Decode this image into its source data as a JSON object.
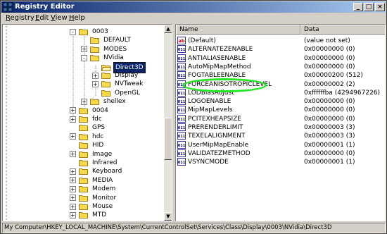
{
  "window": {
    "title": "Registry Editor"
  },
  "menu": [
    {
      "label": "Registry",
      "u": "R",
      "rest": "egistry"
    },
    {
      "label": "Edit",
      "u": "E",
      "rest": "dit"
    },
    {
      "label": "View",
      "u": "V",
      "rest": "iew"
    },
    {
      "label": "Help",
      "u": "H",
      "rest": "elp"
    }
  ],
  "tree": [
    {
      "label": "0003",
      "expander": "-",
      "level": 0
    },
    {
      "label": "DEFAULT",
      "expander": "",
      "level": 1
    },
    {
      "label": "MODES",
      "expander": "+",
      "level": 1
    },
    {
      "label": "NVidia",
      "expander": "-",
      "level": 1
    },
    {
      "label": "Direct3D",
      "expander": "",
      "level": 2,
      "selected": true
    },
    {
      "label": "Display",
      "expander": "+",
      "level": 2
    },
    {
      "label": "NVTweak",
      "expander": "+",
      "level": 2
    },
    {
      "label": "OpenGL",
      "expander": "",
      "level": 2
    },
    {
      "label": "shellex",
      "expander": "+",
      "level": 1
    },
    {
      "label": "0004",
      "expander": "+",
      "level": 0
    },
    {
      "label": "fdc",
      "expander": "+",
      "level": -1
    },
    {
      "label": "GPS",
      "expander": "",
      "level": -1
    },
    {
      "label": "hdc",
      "expander": "+",
      "level": -1
    },
    {
      "label": "HID",
      "expander": "",
      "level": -1
    },
    {
      "label": "Image",
      "expander": "+",
      "level": -1
    },
    {
      "label": "Infrared",
      "expander": "",
      "level": -1
    },
    {
      "label": "Keyboard",
      "expander": "+",
      "level": -1
    },
    {
      "label": "MEDIA",
      "expander": "+",
      "level": -1
    },
    {
      "label": "Modem",
      "expander": "+",
      "level": -1
    },
    {
      "label": "Monitor",
      "expander": "+",
      "level": -1
    },
    {
      "label": "Mouse",
      "expander": "+",
      "level": -1
    },
    {
      "label": "MTD",
      "expander": "+",
      "level": -1
    }
  ],
  "columns": {
    "name": "Name",
    "data": "Data"
  },
  "values": [
    {
      "type": "string",
      "name": "(Default)",
      "data": "(value not set)"
    },
    {
      "type": "binary",
      "name": "ALTERNATEZENABLE",
      "data": "0x00000000 (0)"
    },
    {
      "type": "binary",
      "name": "ANTIALIASENABLE",
      "data": "0x00000000 (0)"
    },
    {
      "type": "binary",
      "name": "AutoMipMapMethod",
      "data": "0x00000000 (0)"
    },
    {
      "type": "binary",
      "name": "FOGTABLEENABLE",
      "data": "0x00000200 (512)"
    },
    {
      "type": "binary",
      "name": "FORCEANISOTROPICLEVEL",
      "data": "0x00000002 (2)"
    },
    {
      "type": "binary",
      "name": "LODBiasAdjust",
      "data": "0xffffffba (4294967226)"
    },
    {
      "type": "binary",
      "name": "LOGOENABLE",
      "data": "0x00000000 (0)"
    },
    {
      "type": "binary",
      "name": "MipMapLevels",
      "data": "0x00000000 (0)"
    },
    {
      "type": "binary",
      "name": "PCITEXHEAPSIZE",
      "data": "0x00000000 (0)"
    },
    {
      "type": "binary",
      "name": "PRERENDERLIMIT",
      "data": "0x00000003 (3)"
    },
    {
      "type": "binary",
      "name": "TEXELALIGNMENT",
      "data": "0x00000003 (3)"
    },
    {
      "type": "binary",
      "name": "UserMipMapEnable",
      "data": "0x00000001 (1)"
    },
    {
      "type": "binary",
      "name": "VALIDATEZMETHOD",
      "data": "0x00000000 (0)"
    },
    {
      "type": "binary",
      "name": "VSYNCMODE",
      "data": "0x00000001 (1)"
    }
  ],
  "status": "My Computer\\HKEY_LOCAL_MACHINE\\System\\CurrentControlSet\\Services\\Class\\Display\\0003\\NVidia\\Direct3D",
  "colors": {
    "titlebar_start": "#0a246a",
    "titlebar_end": "#a6caf0",
    "selection": "#0a246a",
    "folder": "#f4d94a",
    "annotation": "#22e622"
  },
  "annotation": {
    "shape": "green-oval",
    "target": "FORCEANISOTROPICLEVEL"
  }
}
